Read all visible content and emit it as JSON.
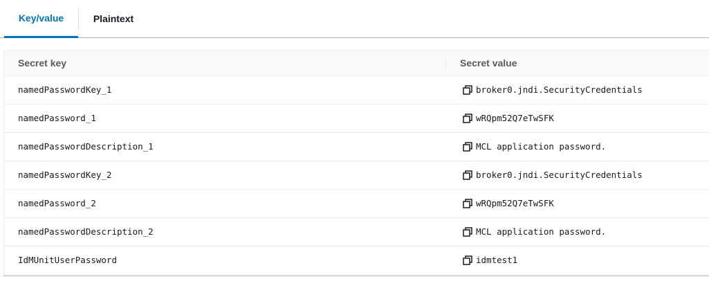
{
  "tabs": [
    {
      "label": "Key/value",
      "active": true
    },
    {
      "label": "Plaintext",
      "active": false
    }
  ],
  "table": {
    "columns": {
      "key": "Secret key",
      "value": "Secret value"
    },
    "rows": [
      {
        "key": "namedPasswordKey_1",
        "value": "broker0.jndi.SecurityCredentials"
      },
      {
        "key": "namedPassword_1",
        "value": "wRQpm52Q7eTwSFK"
      },
      {
        "key": "namedPasswordDescription_1",
        "value": "MCL application password."
      },
      {
        "key": "namedPasswordKey_2",
        "value": "broker0.jndi.SecurityCredentials"
      },
      {
        "key": "namedPassword_2",
        "value": "wRQpm52Q7eTwSFK"
      },
      {
        "key": "namedPasswordDescription_2",
        "value": "MCL application password."
      },
      {
        "key": "IdMUnitUserPassword",
        "value": "idmtest1"
      }
    ],
    "value_icon": "copy-icon"
  },
  "colors": {
    "accent": "#0073bb",
    "text": "#16191f",
    "header_text": "#545b64",
    "border": "#eaeded"
  }
}
